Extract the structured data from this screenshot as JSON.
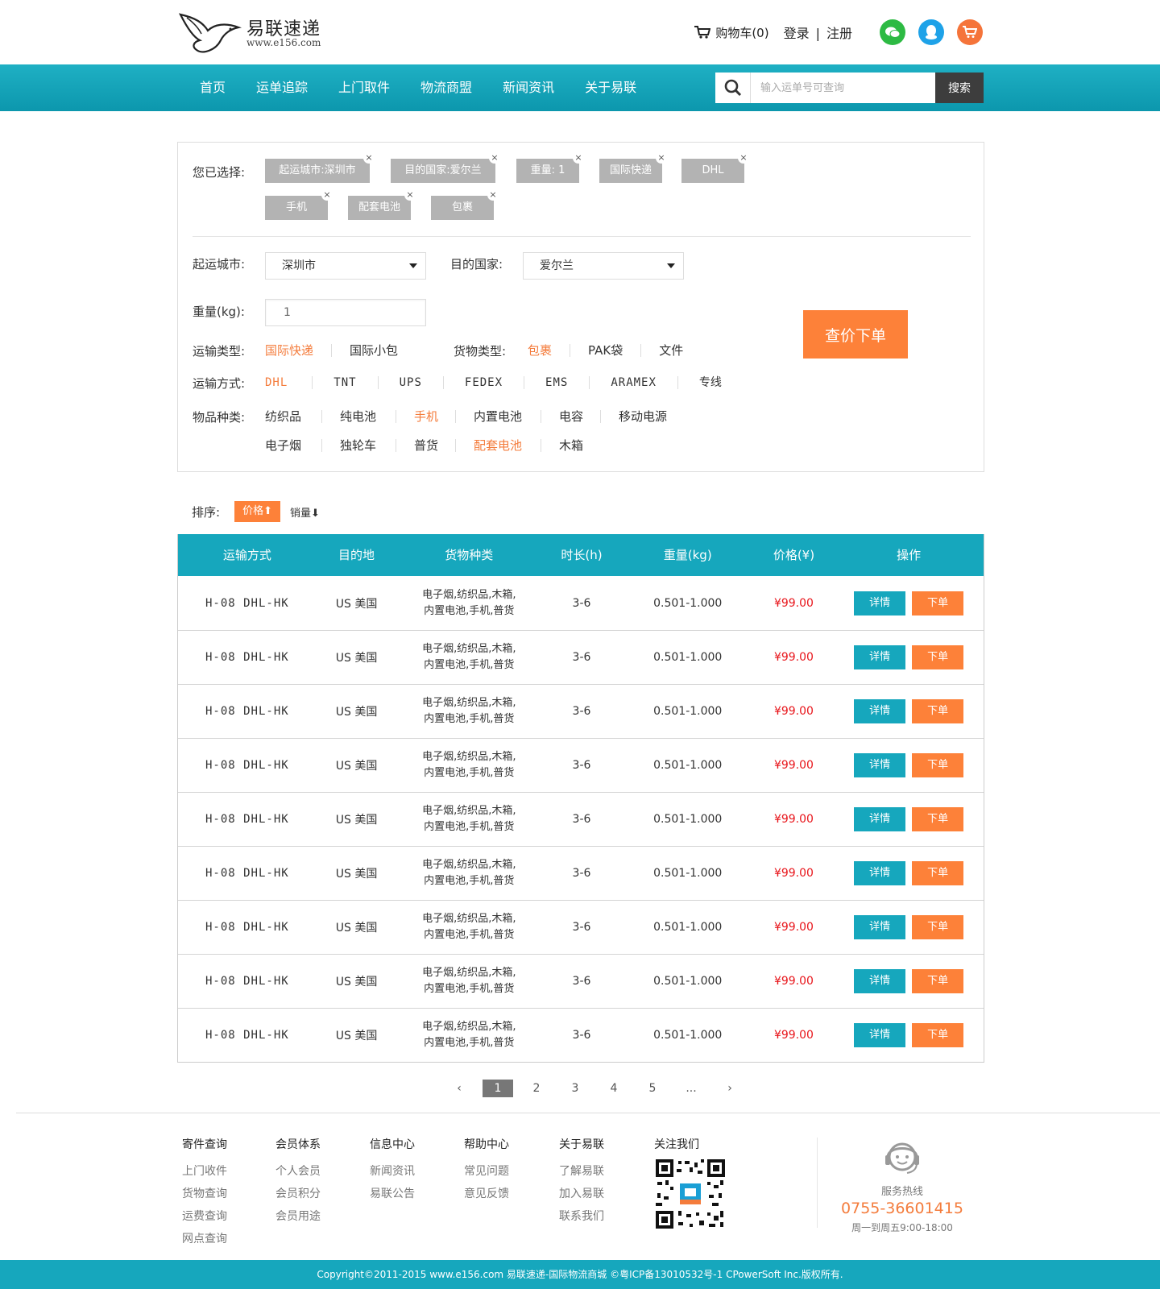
{
  "header": {
    "logo_cn": "易联速递",
    "logo_url": "www.e156.com",
    "cart_label": "购物车(0)",
    "login": "登录",
    "separator": "|",
    "register": "注册"
  },
  "nav": {
    "items": [
      "首页",
      "运单追踪",
      "上门取件",
      "物流商盟",
      "新闻资讯",
      "关于易联"
    ],
    "search_placeholder": "输入运单号可查询",
    "search_button": "搜索"
  },
  "filter": {
    "selected_label": "您已选择:",
    "chips": [
      "起运城市:深圳市",
      "目的国家:爱尔兰",
      "重量: 1",
      "国际快递",
      "DHL",
      "手机",
      "配套电池",
      "包裹"
    ],
    "origin_label": "起运城市:",
    "origin_value": "深圳市",
    "dest_label": "目的国家:",
    "dest_value": "爱尔兰",
    "weight_label": "重量(kg):",
    "weight_value": "1",
    "quote_button": "查价下单",
    "transport_type_label": "运输类型:",
    "transport_types": [
      "国际快递",
      "国际小包"
    ],
    "cargo_type_label": "货物类型:",
    "cargo_types": [
      "包裹",
      "PAK袋",
      "文件"
    ],
    "method_label": "运输方式:",
    "methods": [
      "DHL",
      "TNT",
      "UPS",
      "FEDEX",
      "EMS",
      "ARAMEX",
      "专线"
    ],
    "goods_label": "物品种类:",
    "goods_row1": [
      "纺织品",
      "纯电池",
      "手机",
      "内置电池",
      "电容",
      "移动电源"
    ],
    "goods_row2": [
      "电子烟",
      "独轮车",
      "普货",
      "配套电池",
      "木箱"
    ]
  },
  "sort": {
    "label": "排序:",
    "price": "价格⬆",
    "sales": "销量⬇"
  },
  "table": {
    "headers": [
      "运输方式",
      "目的地",
      "货物种类",
      "时长(h)",
      "重量(kg)",
      "价格(¥)",
      "操作"
    ],
    "detail_label": "详情",
    "order_label": "下单",
    "rows": [
      {
        "method": "H-08 DHL-HK",
        "dest": "US 美国",
        "cargo1": "电子烟,纺织品,木箱,",
        "cargo2": "内置电池,手机,普货",
        "duration": "3-6",
        "weight": "0.501-1.000",
        "price": "¥99.00"
      },
      {
        "method": "H-08 DHL-HK",
        "dest": "US 美国",
        "cargo1": "电子烟,纺织品,木箱,",
        "cargo2": "内置电池,手机,普货",
        "duration": "3-6",
        "weight": "0.501-1.000",
        "price": "¥99.00"
      },
      {
        "method": "H-08 DHL-HK",
        "dest": "US 美国",
        "cargo1": "电子烟,纺织品,木箱,",
        "cargo2": "内置电池,手机,普货",
        "duration": "3-6",
        "weight": "0.501-1.000",
        "price": "¥99.00"
      },
      {
        "method": "H-08 DHL-HK",
        "dest": "US 美国",
        "cargo1": "电子烟,纺织品,木箱,",
        "cargo2": "内置电池,手机,普货",
        "duration": "3-6",
        "weight": "0.501-1.000",
        "price": "¥99.00"
      },
      {
        "method": "H-08 DHL-HK",
        "dest": "US 美国",
        "cargo1": "电子烟,纺织品,木箱,",
        "cargo2": "内置电池,手机,普货",
        "duration": "3-6",
        "weight": "0.501-1.000",
        "price": "¥99.00"
      },
      {
        "method": "H-08 DHL-HK",
        "dest": "US 美国",
        "cargo1": "电子烟,纺织品,木箱,",
        "cargo2": "内置电池,手机,普货",
        "duration": "3-6",
        "weight": "0.501-1.000",
        "price": "¥99.00"
      },
      {
        "method": "H-08 DHL-HK",
        "dest": "US 美国",
        "cargo1": "电子烟,纺织品,木箱,",
        "cargo2": "内置电池,手机,普货",
        "duration": "3-6",
        "weight": "0.501-1.000",
        "price": "¥99.00"
      },
      {
        "method": "H-08 DHL-HK",
        "dest": "US 美国",
        "cargo1": "电子烟,纺织品,木箱,",
        "cargo2": "内置电池,手机,普货",
        "duration": "3-6",
        "weight": "0.501-1.000",
        "price": "¥99.00"
      },
      {
        "method": "H-08 DHL-HK",
        "dest": "US 美国",
        "cargo1": "电子烟,纺织品,木箱,",
        "cargo2": "内置电池,手机,普货",
        "duration": "3-6",
        "weight": "0.501-1.000",
        "price": "¥99.00"
      }
    ]
  },
  "pager": {
    "prev": "‹",
    "pages": [
      "1",
      "2",
      "3",
      "4",
      "5",
      "..."
    ],
    "next": "›"
  },
  "footer": {
    "columns": [
      {
        "title": "寄件查询",
        "links": [
          "上门收件",
          "货物查询",
          "运费查询",
          "网点查询"
        ]
      },
      {
        "title": "会员体系",
        "links": [
          "个人会员",
          "会员积分",
          "会员用途"
        ]
      },
      {
        "title": "信息中心",
        "links": [
          "新闻资讯",
          "易联公告"
        ]
      },
      {
        "title": "帮助中心",
        "links": [
          "常见问题",
          "意见反馈"
        ]
      },
      {
        "title": "关于易联",
        "links": [
          "了解易联",
          "加入易联",
          "联系我们"
        ]
      },
      {
        "title": "关注我们",
        "links": []
      }
    ],
    "hotline_label": "服务热线",
    "hotline_number": "0755-36601415",
    "hotline_hours": "周一到周五9:00-18:00",
    "copyright": "Copyright©2011-2015 www.e156.com 易联速递-国际物流商城 ©粤ICP备13010532号-1 CPowerSoft Inc.版权所有."
  },
  "colors": {
    "accent": "#16a7bd",
    "orange": "#fd8139",
    "price_red": "#e8141a"
  }
}
